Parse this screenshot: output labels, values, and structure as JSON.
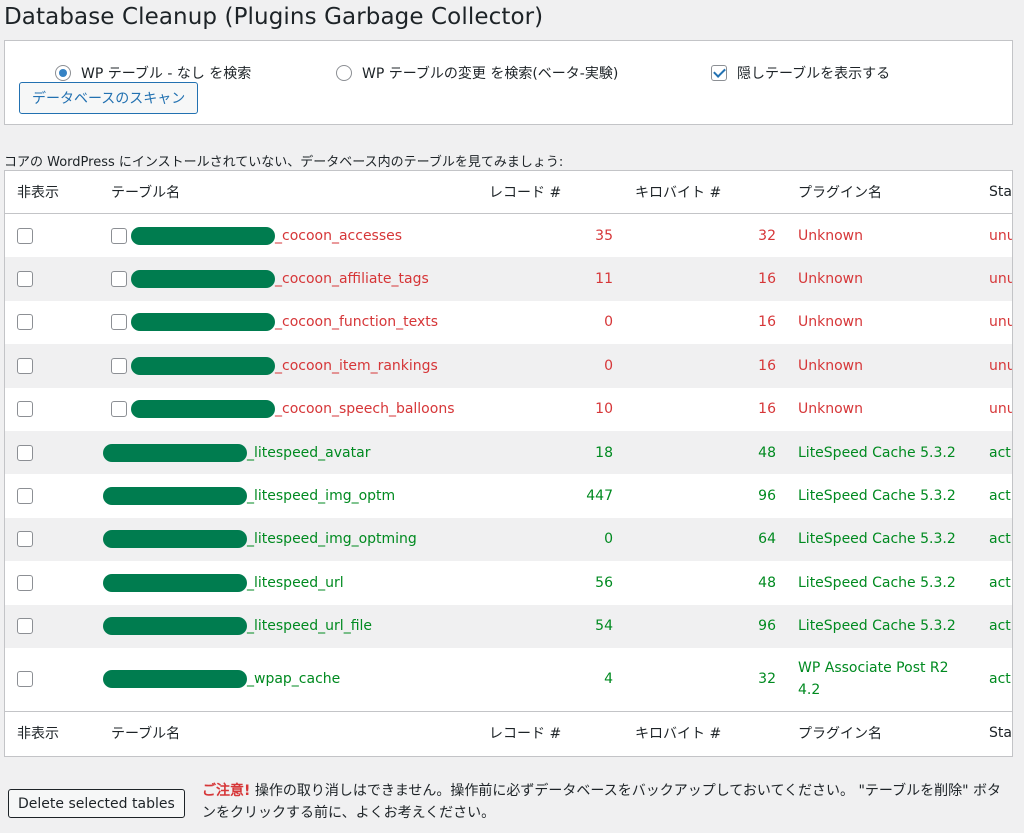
{
  "title": "Database Cleanup (Plugins Garbage Collector)",
  "scan": {
    "opt1": "WP テーブル - なし を検索",
    "opt2": "WP テーブルの変更 を検索(ベータ-実験)",
    "opt3": "隠しテーブルを表示する",
    "button": "データベースのスキャン"
  },
  "intro": "コアの WordPress にインストールされていない、データベース内のテーブルを見てみましょう:",
  "columns": {
    "hide": "非表示",
    "table": "テーブル名",
    "records": "レコード #",
    "kb": "キロバイト #",
    "plugin": "プラグイン名",
    "state": "State"
  },
  "rows": [
    {
      "name": "_cocoon_accesses",
      "records": "35",
      "kb": "32",
      "plugin": "Unknown",
      "state": "unused"
    },
    {
      "name": "_cocoon_affiliate_tags",
      "records": "11",
      "kb": "16",
      "plugin": "Unknown",
      "state": "unused"
    },
    {
      "name": "_cocoon_function_texts",
      "records": "0",
      "kb": "16",
      "plugin": "Unknown",
      "state": "unused"
    },
    {
      "name": "_cocoon_item_rankings",
      "records": "0",
      "kb": "16",
      "plugin": "Unknown",
      "state": "unused"
    },
    {
      "name": "_cocoon_speech_balloons",
      "records": "10",
      "kb": "16",
      "plugin": "Unknown",
      "state": "unused"
    },
    {
      "name": "_litespeed_avatar",
      "records": "18",
      "kb": "48",
      "plugin": "LiteSpeed Cache 5.3.2",
      "state": "active"
    },
    {
      "name": "_litespeed_img_optm",
      "records": "447",
      "kb": "96",
      "plugin": "LiteSpeed Cache 5.3.2",
      "state": "active"
    },
    {
      "name": "_litespeed_img_optming",
      "records": "0",
      "kb": "64",
      "plugin": "LiteSpeed Cache 5.3.2",
      "state": "active"
    },
    {
      "name": "_litespeed_url",
      "records": "56",
      "kb": "48",
      "plugin": "LiteSpeed Cache 5.3.2",
      "state": "active"
    },
    {
      "name": "_litespeed_url_file",
      "records": "54",
      "kb": "96",
      "plugin": "LiteSpeed Cache 5.3.2",
      "state": "active"
    },
    {
      "name": "_wpap_cache",
      "records": "4",
      "kb": "32",
      "plugin": "WP Associate Post R2 4.2",
      "state": "active"
    }
  ],
  "delete_button": "Delete selected tables",
  "warning": {
    "strong": "ご注意!",
    "text": " 操作の取り消しはできません。操作前に必ずデータベースをバックアップしておいてください。 \"テーブルを削除\" ボタンをクリックする前に、よくお考えください。"
  }
}
